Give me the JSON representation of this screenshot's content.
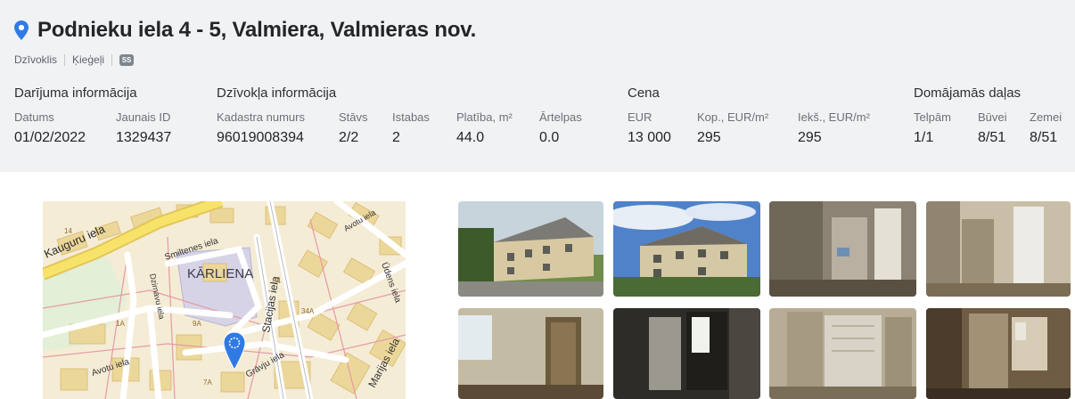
{
  "listing": {
    "address": "Podnieku iela 4 - 5, Valmiera, Valmieras nov.",
    "tags": [
      "Dzīvoklis",
      "Ķieģeļi"
    ],
    "badge": "SS"
  },
  "sections": {
    "deal": {
      "title": "Darījuma informācija"
    },
    "apartment": {
      "title": "Dzīvokļa informācija"
    },
    "price": {
      "title": "Cena"
    },
    "shares": {
      "title": "Domājamās daļas"
    }
  },
  "fields": {
    "date": {
      "label": "Datums",
      "value": "01/02/2022"
    },
    "new_id": {
      "label": "Jaunais ID",
      "value": "1329437"
    },
    "cadastre": {
      "label": "Kadastra numurs",
      "value": "96019008394"
    },
    "floor": {
      "label": "Stāvs",
      "value": "2/2"
    },
    "rooms": {
      "label": "Istabas",
      "value": "2"
    },
    "area": {
      "label": "Platība, m²",
      "value": "44.0"
    },
    "outer_rooms": {
      "label": "Ārtelpas",
      "value": "0.0"
    },
    "eur": {
      "label": "EUR",
      "value": "13 000"
    },
    "total_per_m2": {
      "label": "Kop., EUR/m²",
      "value": "295"
    },
    "inner_per_m2": {
      "label": "Iekš., EUR/m²",
      "value": "295"
    },
    "premises": {
      "label": "Telpām",
      "value": "1/1"
    },
    "building": {
      "label": "Būvei",
      "value": "8/51"
    },
    "land": {
      "label": "Zemei",
      "value": "8/51"
    }
  },
  "map": {
    "labels": {
      "kauguru": "Kauguru iela",
      "smiltenes": "Smiltenes iela",
      "karliena": "KĀRLIENA",
      "stacijas": "Stacijas iela",
      "avotu_top": "Avotu iela",
      "udens": "Ūdens iela",
      "dzirnavu": "Dzirnavu iela",
      "avotu_left": "Avotu iela",
      "grvju": "Grāvju iela",
      "marijas": "Marijas iela",
      "n34": "34",
      "n34a": "34A",
      "n9a": "9A",
      "n7a": "7A",
      "n1a": "1A",
      "n14": "14"
    },
    "colors": {
      "pin": "#2f7ae5",
      "road_outline": "#e59aa6",
      "block": "#ecd79a",
      "district": "#d6d3e6"
    }
  },
  "photos": {
    "items": [
      {
        "alt": "Building exterior"
      },
      {
        "alt": "Building exterior with sky"
      },
      {
        "alt": "Interior room with doors"
      },
      {
        "alt": "Interior room with door"
      },
      {
        "alt": "Room with window"
      },
      {
        "alt": "Dark doorway"
      },
      {
        "alt": "Room with radiator"
      },
      {
        "alt": "Worn room"
      }
    ]
  }
}
